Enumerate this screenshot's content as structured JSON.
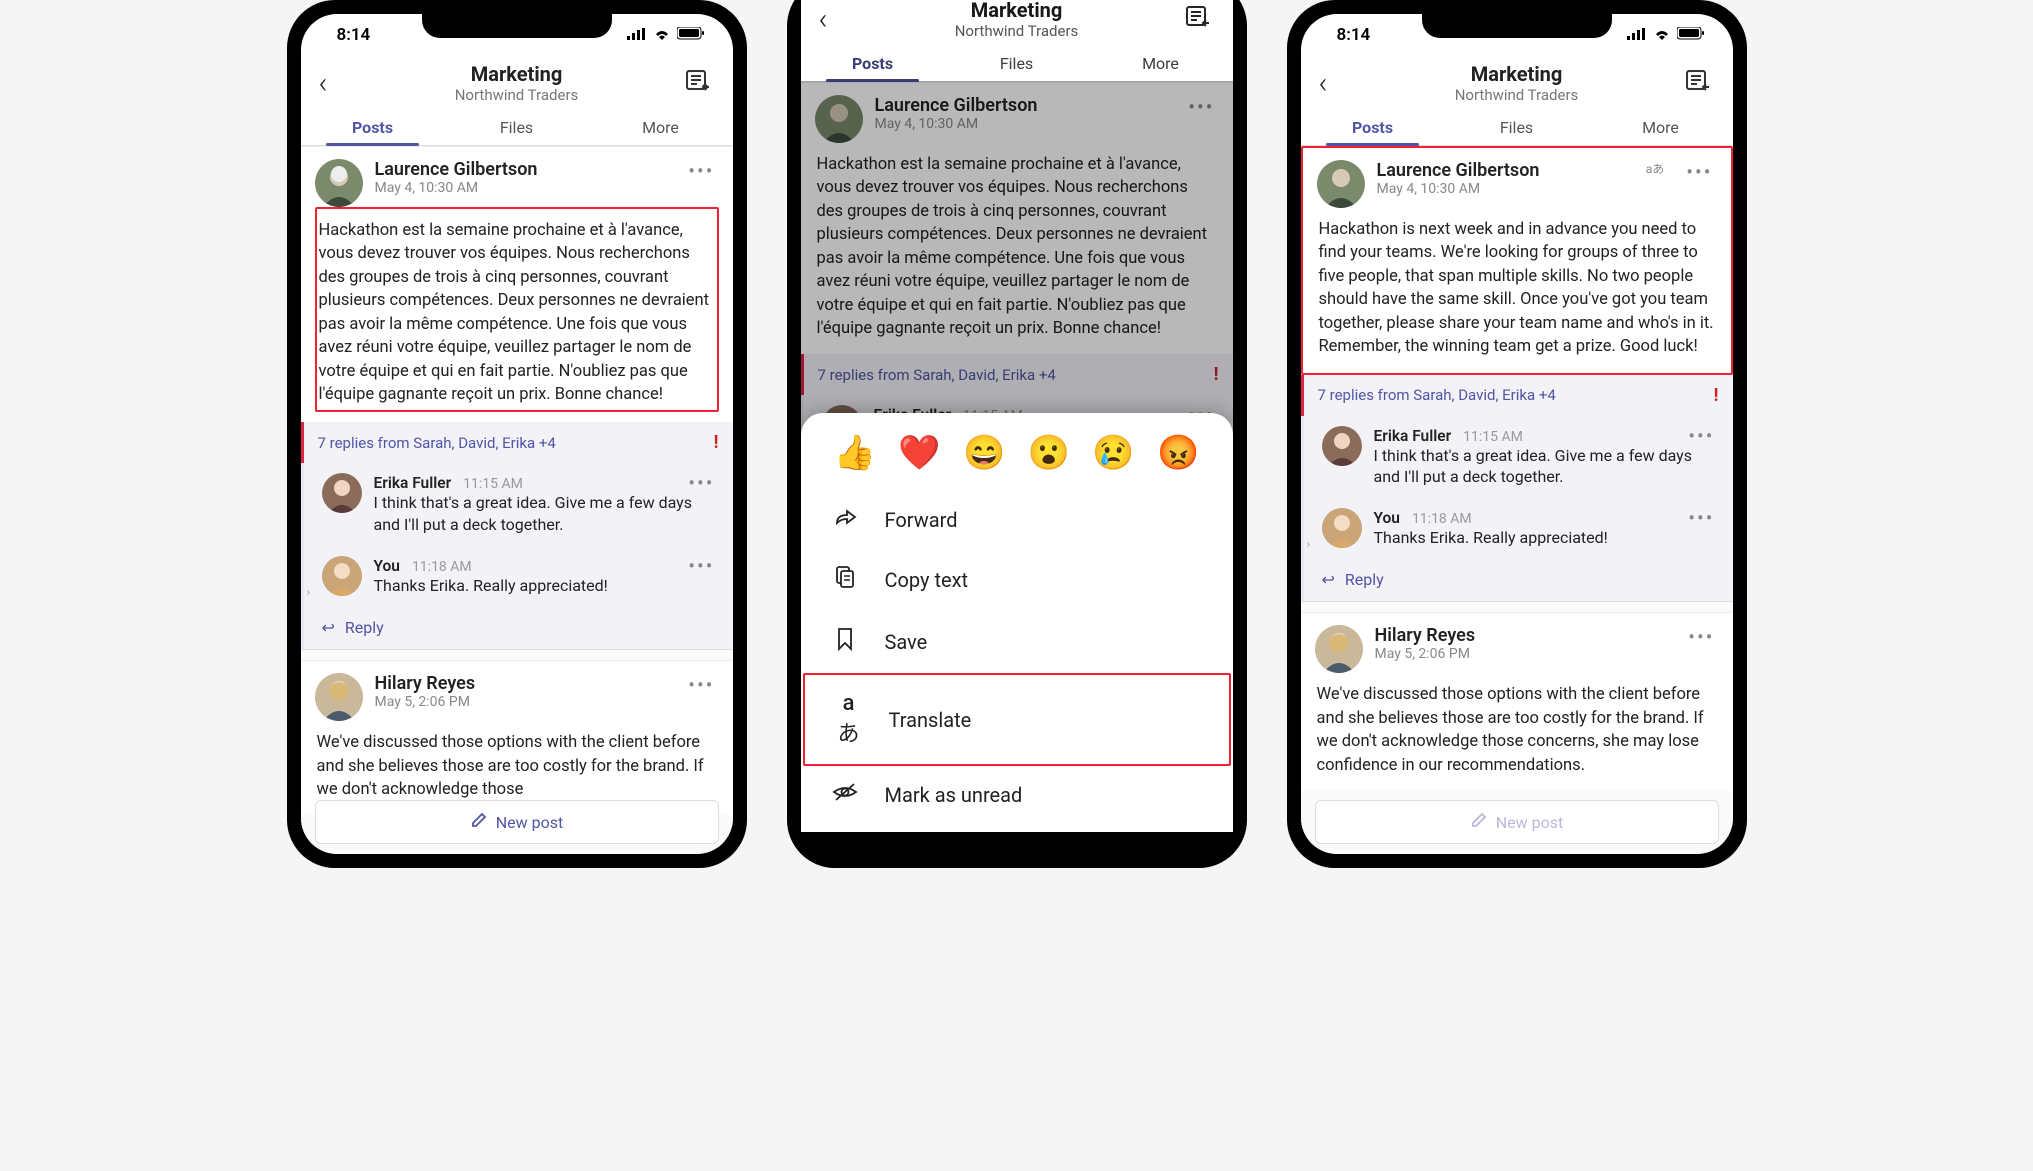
{
  "status": {
    "time": "8:14"
  },
  "header": {
    "title": "Marketing",
    "subtitle": "Northwind Traders"
  },
  "tabs": {
    "posts": "Posts",
    "files": "Files",
    "more": "More"
  },
  "post1_fr": {
    "author": "Laurence Gilbertson",
    "time": "May 4, 10:30 AM",
    "body": "Hackathon est la semaine prochaine et à l'avance, vous devez trouver vos équipes. Nous recherchons des groupes de trois à cinq personnes, couvrant plusieurs compétences. Deux personnes ne devraient pas avoir la même compétence. Une fois que vous avez réuni votre équipe, veuillez partager le nom de votre équipe et qui en fait partie. N'oubliez pas que l'équipe gagnante reçoit un prix. Bonne chance!"
  },
  "post1_en": {
    "author": "Laurence Gilbertson",
    "time": "May 4, 10:30 AM",
    "body": "Hackathon is next week and in advance you need to find your teams. We're looking for groups of three to five people, that span multiple skills. No two people should have the same skill. Once you've got you team together, please share your team name and who's in it. Remember, the winning team get a prize. Good luck!"
  },
  "replies_bar": "7 replies from Sarah, David, Erika +4",
  "reply1": {
    "author": "Erika Fuller",
    "time": "11:15 AM",
    "body": "I think that's a great idea. Give me a few days and I'll put a deck together."
  },
  "reply2": {
    "author": "You",
    "time": "11:18 AM",
    "body": "Thanks Erika. Really appreciated!"
  },
  "reply_label": "Reply",
  "post2": {
    "author": "Hilary Reyes",
    "time": "May 5, 2:06 PM",
    "body_short": "We've discussed those options with the client before and she believes those are too costly for the brand. If we don't acknowledge those",
    "body_long": "We've discussed those options with the client before and she believes those are too costly for the brand. If we don't acknowledge those concerns, she may lose confidence in our recommendations."
  },
  "newpost": "New post",
  "menu": {
    "forward": "Forward",
    "copy": "Copy text",
    "save": "Save",
    "translate": "Translate",
    "unread": "Mark as unread"
  },
  "emojis": [
    "👍",
    "❤️",
    "😄",
    "😮",
    "😢",
    "😡"
  ]
}
